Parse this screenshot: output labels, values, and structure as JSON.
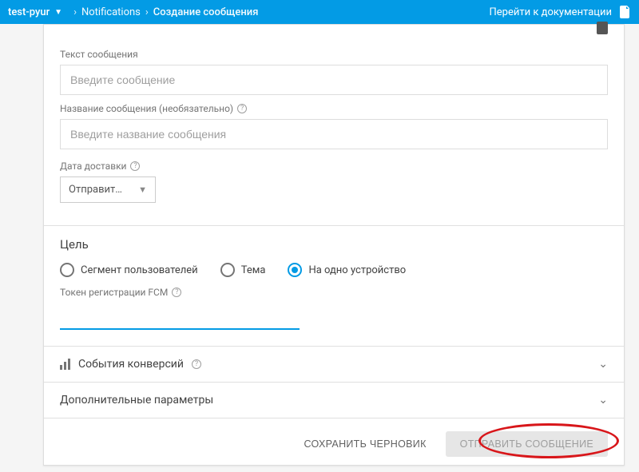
{
  "header": {
    "project": "test-pyur",
    "crumb1": "Notifications",
    "crumb2": "Создание сообщения",
    "docs_link": "Перейти к документации"
  },
  "form": {
    "message_text": {
      "label": "Текст сообщения",
      "placeholder": "Введите сообщение",
      "value": ""
    },
    "message_title": {
      "label": "Название сообщения (необязательно)",
      "placeholder": "Введите название сообщения",
      "value": ""
    },
    "delivery": {
      "label": "Дата доставки",
      "selected": "Отправит…"
    }
  },
  "target": {
    "heading": "Цель",
    "options": {
      "segment": "Сегмент пользователей",
      "topic": "Тема",
      "single": "На одно устройство"
    },
    "selected": "single",
    "token_label": "Токен регистрации FCM",
    "token_value": ""
  },
  "collapsibles": {
    "conversions": "События конверсий",
    "advanced": "Дополнительные параметры"
  },
  "footer": {
    "save_draft": "СОХРАНИТЬ ЧЕРНОВИК",
    "send": "ОТПРАВИТЬ СООБЩЕНИЕ"
  }
}
